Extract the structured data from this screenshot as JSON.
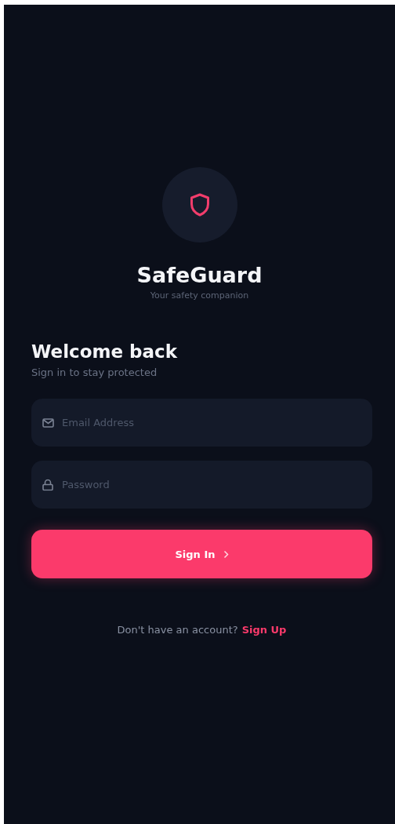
{
  "brand": {
    "name": "SafeGuard",
    "tagline": "Your safety companion"
  },
  "heading": {
    "title": "Welcome back",
    "subtitle": "Sign in to stay protected"
  },
  "fields": [
    {
      "kind": "email",
      "placeholder": "Email Address"
    },
    {
      "kind": "password",
      "placeholder": "Password"
    }
  ],
  "submit": {
    "label": "Sign In"
  },
  "footer": {
    "prompt": "Don't have an account?",
    "link": "Sign Up"
  }
}
